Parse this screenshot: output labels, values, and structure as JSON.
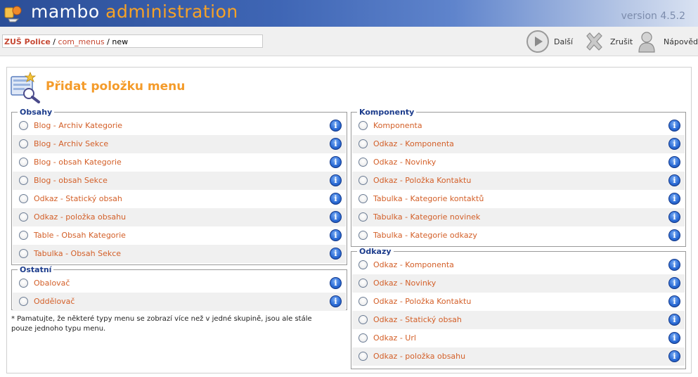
{
  "header": {
    "brand_main": "mambo ",
    "brand_accent": "administration",
    "version": "version 4.5.2"
  },
  "pathway": {
    "site": "ZUŠ Police",
    "sep1": " / ",
    "component": "com_menus",
    "sep2": " / ",
    "current": "new"
  },
  "toolbar": {
    "next_label": "Další",
    "cancel_label": "Zrušit",
    "help_label": "Nápověda"
  },
  "page": {
    "title": "Přidat položku menu",
    "title_icon": "menu-item-icon",
    "note": "* Pamatujte, že některé typy menu se zobrazí více než v jedné skupině, jsou ale stále pouze jednoho typu menu."
  },
  "groups": {
    "obsahy": {
      "legend": "Obsahy",
      "items": [
        "Blog - Archiv Kategorie",
        "Blog - Archiv Sekce",
        "Blog - obsah Kategorie",
        "Blog - obsah Sekce",
        "Odkaz - Statický obsah",
        "Odkaz - položka obsahu",
        "Table - Obsah Kategorie",
        "Tabulka - Obsah Sekce"
      ]
    },
    "ostatni": {
      "legend": "Ostatní",
      "items": [
        "Obalovač",
        "Oddělovač"
      ]
    },
    "komponenty": {
      "legend": "Komponenty",
      "items": [
        "Komponenta",
        "Odkaz - Komponenta",
        "Odkaz - Novinky",
        "Odkaz - Položka Kontaktu",
        "Tabulka - Kategorie kontaktů",
        "Tabulka - Kategorie novinek",
        "Tabulka - Kategorie odkazy"
      ]
    },
    "odkazy": {
      "legend": "Odkazy",
      "items": [
        "Odkaz - Komponenta",
        "Odkaz - Novinky",
        "Odkaz - Položka Kontaktu",
        "Odkaz - Statický obsah",
        "Odkaz - Url",
        "Odkaz - položka obsahu"
      ]
    }
  },
  "info_icon_letter": "i",
  "colors": {
    "accent_orange": "#f49b2a",
    "link_orange": "#d35f28",
    "legend_blue": "#1c3c8c",
    "header_blue": "#2b4e97"
  }
}
